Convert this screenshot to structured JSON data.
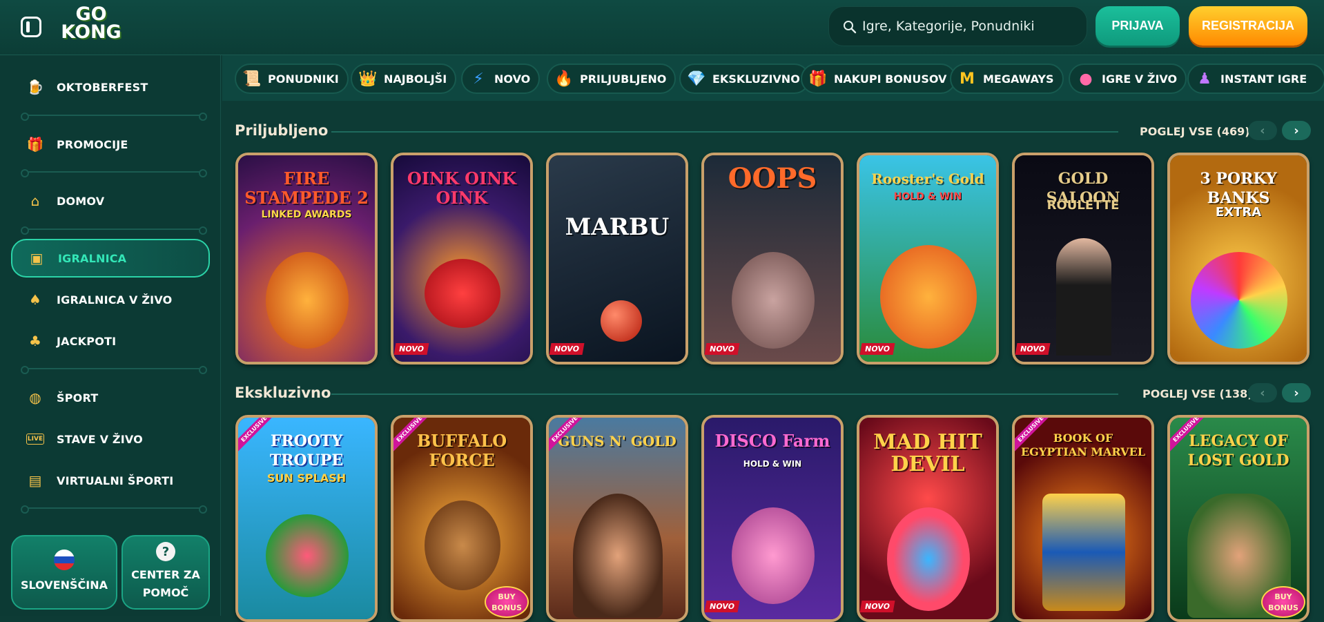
{
  "header": {
    "logo_top": "GO",
    "logo_bottom": "KONG",
    "search_placeholder": "Igre, Kategorije, Ponudniki",
    "login_label": "PRIJAVA",
    "register_label": "REGISTRACIJA"
  },
  "sidebar": {
    "items": [
      {
        "label": "OKTOBERFEST",
        "icon": "beer-mug-icon"
      },
      {
        "label": "PROMOCIJE",
        "icon": "gift-icon"
      },
      {
        "label": "DOMOV",
        "icon": "home-icon"
      },
      {
        "label": "IGRALNICA",
        "icon": "slot-machine-icon"
      },
      {
        "label": "IGRALNICA V ŽIVO",
        "icon": "playing-card-icon"
      },
      {
        "label": "JACKPOTI",
        "icon": "clover-icon"
      },
      {
        "label": "ŠPORT",
        "icon": "basketball-icon"
      },
      {
        "label": "STAVE V ŽIVO",
        "icon": "live-icon"
      },
      {
        "label": "VIRTUALNI ŠPORTI",
        "icon": "monitor-ball-icon"
      }
    ],
    "language_label": "SLOVENŠČINA",
    "help_label_1": "CENTER ZA",
    "help_label_2": "POMOČ"
  },
  "categories": [
    {
      "label": "PONUDNIKI",
      "icon": "scroll-icon"
    },
    {
      "label": "NAJBOLJŠI",
      "icon": "crown-icon"
    },
    {
      "label": "NOVO",
      "icon": "lightning-icon"
    },
    {
      "label": "PRILJUBLJENO",
      "icon": "flame-icon"
    },
    {
      "label": "EKSKLUZIVNO",
      "icon": "diamond-icon"
    },
    {
      "label": "NAKUPI BONUSOV",
      "icon": "gift-box-icon"
    },
    {
      "label": "MEGAWAYS",
      "icon": "megaways-m-icon"
    },
    {
      "label": "IGRE V ŽIVO",
      "icon": "chip-icon"
    },
    {
      "label": "INSTANT IGRE",
      "icon": "instant-icon"
    }
  ],
  "sections": [
    {
      "title": "Priljubljeno",
      "view_all": "POGLEJ VSE (469)",
      "games": [
        {
          "name": "FIRE STAMPEDE 2",
          "sub": "LINKED AWARDS",
          "badge": ""
        },
        {
          "name": "OINK OINK OINK",
          "sub": "",
          "badge": "NOVO"
        },
        {
          "name": "MARBU",
          "sub": "",
          "badge": "NOVO"
        },
        {
          "name": "OOPS",
          "sub": "",
          "badge": "NOVO"
        },
        {
          "name": "Rooster's Gold",
          "sub": "HOLD & WIN",
          "badge": "NOVO"
        },
        {
          "name": "GOLD SALOON",
          "sub": "ROULETTE",
          "badge": "NOVO"
        },
        {
          "name": "3 PORKY BANKS",
          "sub": "EXTRA",
          "badge": ""
        }
      ]
    },
    {
      "title": "Ekskluzivno",
      "view_all": "POGLEJ VSE (138)",
      "games": [
        {
          "name": "FROOTY TROUPE",
          "sub": "SUN SPLASH",
          "badge": "",
          "excl": "EXCLUSIVE"
        },
        {
          "name": "BUFFALO FORCE",
          "sub": "",
          "badge": "",
          "excl": "EXCLUSIVE",
          "buy": "BUY BONUS"
        },
        {
          "name": "GUNS N' GOLD",
          "sub": "",
          "badge": "",
          "excl": "EXCLUSIVE"
        },
        {
          "name": "DISCO Farm",
          "sub": "HOLD & WIN",
          "badge": "NOVO"
        },
        {
          "name": "MAD HIT DEVIL",
          "sub": "",
          "badge": "NOVO"
        },
        {
          "name": "BOOK OF EGYPTIAN MARVEL",
          "sub": "",
          "badge": "",
          "excl": "EXCLUSIVE"
        },
        {
          "name": "LEGACY OF LOST GOLD",
          "sub": "",
          "badge": "",
          "excl": "EXCLUSIVE",
          "buy": "BUY BONUS"
        }
      ]
    }
  ],
  "colors": {
    "background": "#0d3b35",
    "accent_green": "#1bbf9b",
    "accent_orange": "#ff8a00",
    "card_border": "#c9a06a"
  }
}
